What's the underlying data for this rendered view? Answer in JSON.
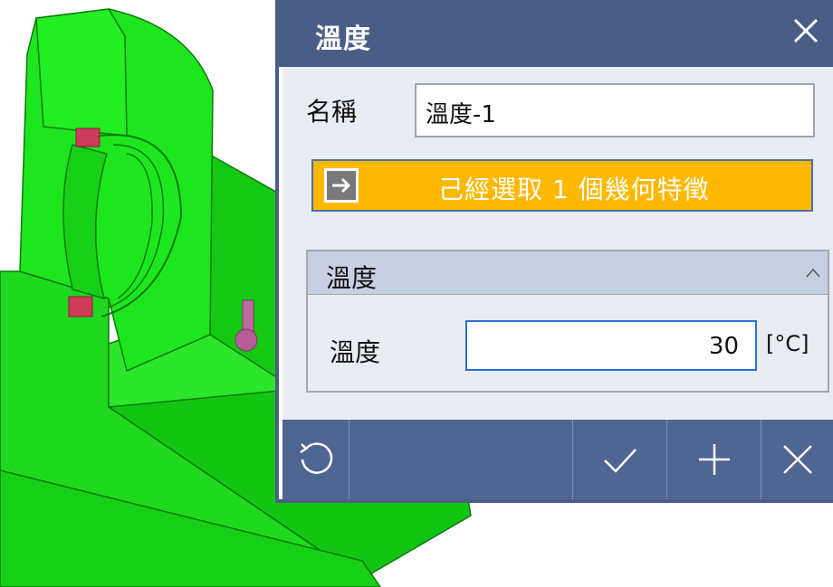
{
  "dialog": {
    "title": "溫度",
    "name_label": "名稱",
    "name_value": "溫度-1",
    "selection_text": "己經選取 1 個幾何特徵",
    "group": {
      "title": "溫度",
      "temperature_label": "溫度",
      "temperature_value": "30",
      "temperature_unit": "[°C]"
    }
  },
  "icons": {
    "close": "close-icon",
    "arrow": "arrow-right-icon",
    "collapse": "chevron-up-icon",
    "reset": "reset-icon",
    "ok": "check-icon",
    "add": "plus-icon",
    "cancel": "cancel-icon"
  },
  "colors": {
    "titlebar": "#4a5d86",
    "selection_button": "#ffb800",
    "part_green": "#1ee61e",
    "toolbar": "#4f6592"
  }
}
